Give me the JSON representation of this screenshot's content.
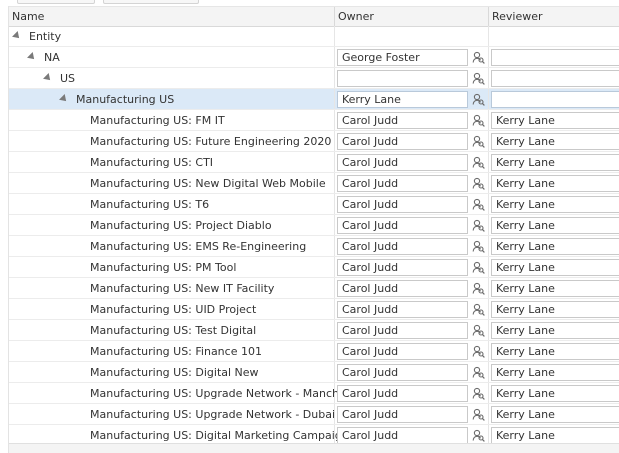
{
  "columns": {
    "name": "Name",
    "owner": "Owner",
    "reviewer": "Reviewer"
  },
  "tree": [
    {
      "label": "Entity",
      "level": 0,
      "expander": true,
      "owner": null,
      "reviewer": null
    },
    {
      "label": "NA",
      "level": 1,
      "expander": true,
      "owner": "George Foster",
      "reviewer": ""
    },
    {
      "label": "US",
      "level": 2,
      "expander": true,
      "owner": "",
      "reviewer": ""
    },
    {
      "label": "Manufacturing US",
      "level": 3,
      "expander": true,
      "owner": "Kerry Lane",
      "reviewer": "",
      "selected": true
    },
    {
      "label": "Manufacturing US: FM IT",
      "level": 4,
      "owner": "Carol Judd",
      "reviewer": "Kerry Lane"
    },
    {
      "label": "Manufacturing US: Future Engineering 2020",
      "level": 4,
      "owner": "Carol Judd",
      "reviewer": "Kerry Lane"
    },
    {
      "label": "Manufacturing US: CTI",
      "level": 4,
      "owner": "Carol Judd",
      "reviewer": "Kerry Lane"
    },
    {
      "label": "Manufacturing US: New Digital Web Mobile",
      "level": 4,
      "owner": "Carol Judd",
      "reviewer": "Kerry Lane"
    },
    {
      "label": "Manufacturing US: T6",
      "level": 4,
      "owner": "Carol Judd",
      "reviewer": "Kerry Lane"
    },
    {
      "label": "Manufacturing US: Project Diablo",
      "level": 4,
      "owner": "Carol Judd",
      "reviewer": "Kerry Lane"
    },
    {
      "label": "Manufacturing US: EMS Re-Engineering",
      "level": 4,
      "owner": "Carol Judd",
      "reviewer": "Kerry Lane"
    },
    {
      "label": "Manufacturing US: PM Tool",
      "level": 4,
      "owner": "Carol Judd",
      "reviewer": "Kerry Lane"
    },
    {
      "label": "Manufacturing US: New IT Facility",
      "level": 4,
      "owner": "Carol Judd",
      "reviewer": "Kerry Lane"
    },
    {
      "label": "Manufacturing US: UID Project",
      "level": 4,
      "owner": "Carol Judd",
      "reviewer": "Kerry Lane"
    },
    {
      "label": "Manufacturing US: Test Digital",
      "level": 4,
      "owner": "Carol Judd",
      "reviewer": "Kerry Lane"
    },
    {
      "label": "Manufacturing US: Finance 101",
      "level": 4,
      "owner": "Carol Judd",
      "reviewer": "Kerry Lane"
    },
    {
      "label": "Manufacturing US: Digital New",
      "level": 4,
      "owner": "Carol Judd",
      "reviewer": "Kerry Lane"
    },
    {
      "label": "Manufacturing US: Upgrade Network - Manchester",
      "level": 4,
      "owner": "Carol Judd",
      "reviewer": "Kerry Lane"
    },
    {
      "label": "Manufacturing US: Upgrade Network - Dubai",
      "level": 4,
      "owner": "Carol Judd",
      "reviewer": "Kerry Lane"
    },
    {
      "label": "Manufacturing US: Digital Marketing Campaign",
      "level": 4,
      "owner": "Carol Judd",
      "reviewer": "Kerry Lane"
    }
  ],
  "icons": {
    "lookup": "person-search-icon",
    "expander": "expanded-triangle-icon"
  }
}
